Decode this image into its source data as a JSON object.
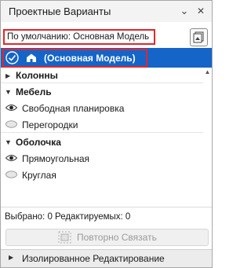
{
  "title": "Проектные Варианты",
  "title_buttons": {
    "menu": "⌄",
    "close": "✕"
  },
  "default_label": "По умолчанию: Основная Модель",
  "selected_row": {
    "label": "(Основная Модель)"
  },
  "groups": [
    {
      "label": "Колонны",
      "expanded": false,
      "items": []
    },
    {
      "label": "Мебель",
      "expanded": true,
      "items": [
        {
          "label": "Свободная планировка",
          "visible": true
        },
        {
          "label": "Перегородки",
          "visible": false
        }
      ]
    },
    {
      "label": "Оболочка",
      "expanded": true,
      "items": [
        {
          "label": "Прямоугольная",
          "visible": true
        },
        {
          "label": "Круглая",
          "visible": false
        }
      ]
    }
  ],
  "status_text": "Выбрано: 0 Редактируемых: 0",
  "relink_button": "Повторно Связать",
  "isolated_edit_label": "Изолированное Редактирование",
  "colors": {
    "selection": "#1565c8",
    "highlight_border": "#e3262b"
  }
}
